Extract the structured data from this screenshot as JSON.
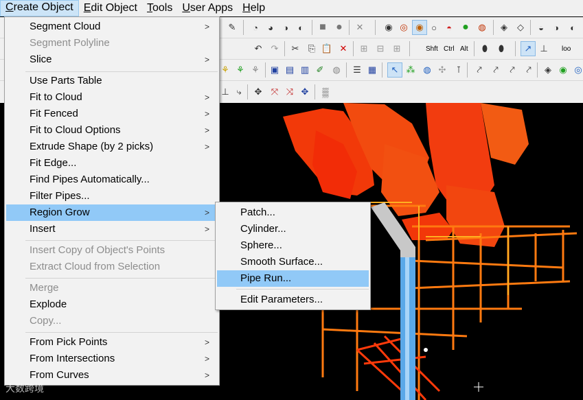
{
  "menubar": {
    "items": [
      {
        "label": "Create Object",
        "u": "C",
        "rest": "reate Object"
      },
      {
        "label": "Edit Object",
        "u": "E",
        "rest": "dit Object"
      },
      {
        "label": "Tools",
        "u": "T",
        "rest": "ools"
      },
      {
        "label": "User Apps",
        "u": "U",
        "rest": "ser Apps"
      },
      {
        "label": "Help",
        "u": "H",
        "rest": "elp"
      }
    ]
  },
  "toolbar": {
    "labels": {
      "shift": "Shft",
      "ctrl": "Ctrl",
      "alt": "Alt",
      "loo": "loo"
    }
  },
  "create_menu": {
    "items": [
      {
        "label": "Segment Cloud",
        "disabled": false,
        "submenu": true
      },
      {
        "label": "Segment Polyline",
        "disabled": true,
        "submenu": false
      },
      {
        "label": "Slice",
        "disabled": false,
        "submenu": true
      },
      {
        "label": "Use Parts Table",
        "disabled": false,
        "submenu": false
      },
      {
        "label": "Fit to Cloud",
        "disabled": false,
        "submenu": true
      },
      {
        "label": "Fit Fenced",
        "disabled": false,
        "submenu": true
      },
      {
        "label": "Fit to Cloud Options",
        "disabled": false,
        "submenu": true
      },
      {
        "label": "Extrude Shape (by 2 picks)",
        "disabled": false,
        "submenu": true
      },
      {
        "label": "Fit Edge...",
        "disabled": false,
        "submenu": false
      },
      {
        "label": "Find Pipes Automatically...",
        "disabled": false,
        "submenu": false
      },
      {
        "label": "Filter Pipes...",
        "disabled": false,
        "submenu": false
      },
      {
        "label": "Region Grow",
        "disabled": false,
        "submenu": true
      },
      {
        "label": "Insert",
        "disabled": false,
        "submenu": true
      },
      {
        "label": "Insert Copy of Object's Points",
        "disabled": true,
        "submenu": false
      },
      {
        "label": "Extract Cloud from Selection",
        "disabled": true,
        "submenu": false
      },
      {
        "label": "Merge",
        "disabled": true,
        "submenu": false
      },
      {
        "label": "Explode",
        "disabled": false,
        "submenu": false
      },
      {
        "label": "Copy...",
        "disabled": true,
        "submenu": false
      },
      {
        "label": "From Pick Points",
        "disabled": false,
        "submenu": true
      },
      {
        "label": "From Intersections",
        "disabled": false,
        "submenu": true
      },
      {
        "label": "From Curves",
        "disabled": false,
        "submenu": true
      }
    ],
    "highlighted": "Region Grow"
  },
  "region_grow_menu": {
    "items": [
      {
        "label": "Patch..."
      },
      {
        "label": "Cylinder..."
      },
      {
        "label": "Sphere..."
      },
      {
        "label": "Smooth Surface..."
      },
      {
        "label": "Pipe Run..."
      },
      {
        "label": "Edit Parameters..."
      }
    ],
    "highlighted": "Pipe Run..."
  },
  "watermark": "大数跨境",
  "colors": {
    "highlight": "#91c9f7",
    "menu_bg": "#f2f2f2",
    "cloud_orange": "#ff4a10",
    "pipe_blue": "#5aa8e8"
  }
}
